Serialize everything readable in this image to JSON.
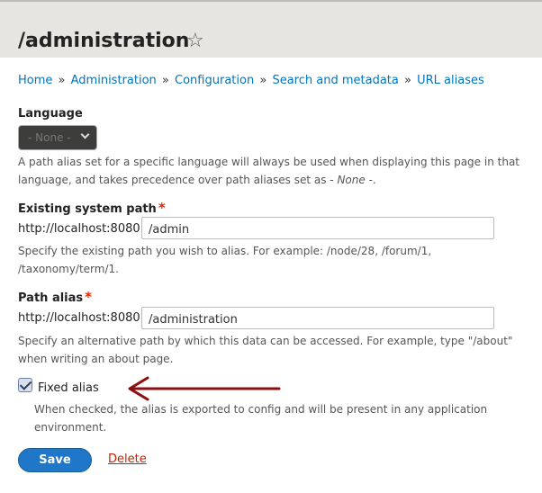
{
  "page": {
    "title": "/administration"
  },
  "breadcrumb": [
    {
      "label": "Home"
    },
    {
      "label": "Administration"
    },
    {
      "label": "Configuration"
    },
    {
      "label": "Search and metadata"
    },
    {
      "label": "URL aliases"
    }
  ],
  "breadcrumb_separator": "»",
  "language": {
    "label": "Language",
    "selected": "- None -",
    "description_before": "A path alias set for a specific language will always be used when displaying this page in that language, and takes precedence over path aliases set as ",
    "description_em": "- None -",
    "description_after": "."
  },
  "system_path": {
    "label": "Existing system path",
    "required_mark": "*",
    "prefix": "http://localhost:8080",
    "value": "/admin",
    "description": "Specify the existing path you wish to alias. For example: /node/28, /forum/1, /taxonomy/term/1."
  },
  "path_alias": {
    "label": "Path alias",
    "required_mark": "*",
    "prefix": "http://localhost:8080",
    "value": "/administration",
    "description": "Specify an alternative path by which this data can be accessed. For example, type \"/about\" when writing an about page."
  },
  "fixed_alias": {
    "label": "Fixed alias",
    "checked": true,
    "description": "When checked, the alias is exported to config and will be present in any application environment."
  },
  "actions": {
    "save": "Save",
    "delete": "Delete"
  },
  "colors": {
    "link": "#0074bd",
    "primary_button": "#1f77c9",
    "required": "#e32700",
    "delete_link": "#c72100",
    "annotation_arrow": "#8b0f0f"
  },
  "icons": {
    "favorite": "star-outline-icon",
    "select": "chevron-down-icon",
    "annotation": "arrow-left-icon"
  }
}
